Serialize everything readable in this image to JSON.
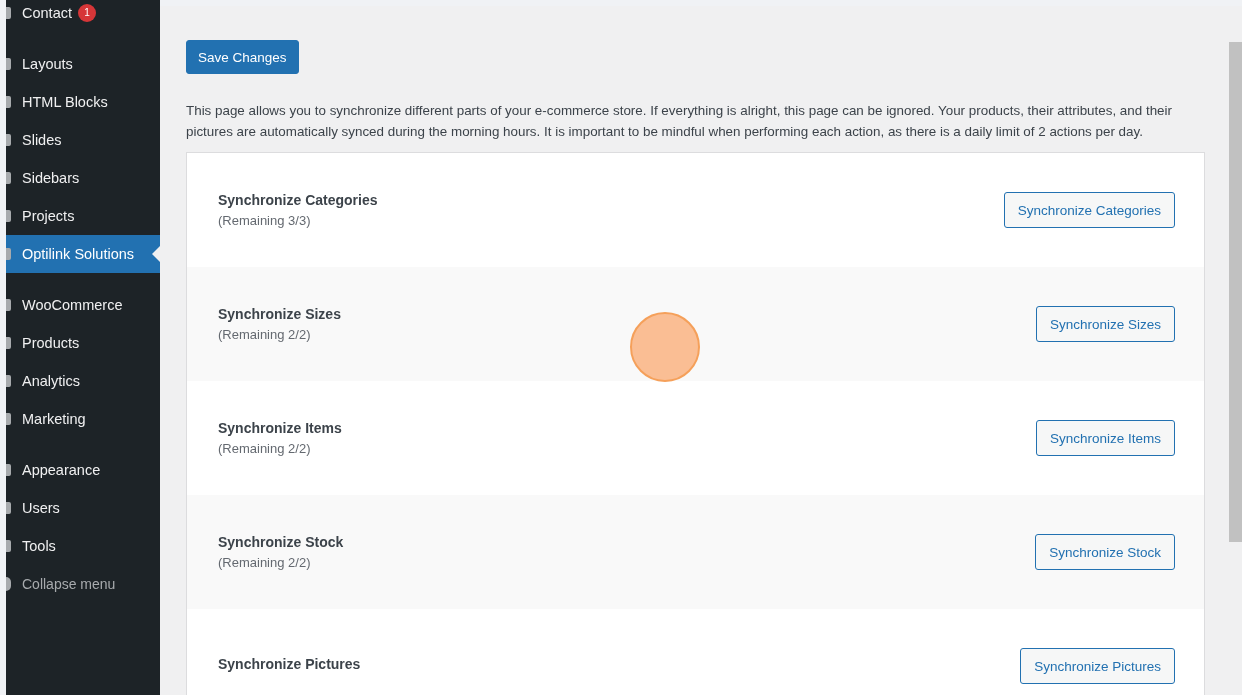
{
  "sidebar": {
    "items": [
      {
        "kind": "item",
        "label": "Contact",
        "badge": "1",
        "selected": false
      },
      {
        "kind": "separator"
      },
      {
        "kind": "item",
        "label": "Layouts",
        "selected": false
      },
      {
        "kind": "item",
        "label": "HTML Blocks",
        "selected": false
      },
      {
        "kind": "item",
        "label": "Slides",
        "selected": false
      },
      {
        "kind": "item",
        "label": "Sidebars",
        "selected": false
      },
      {
        "kind": "item",
        "label": "Projects",
        "selected": false
      },
      {
        "kind": "item",
        "label": "Optilink Solutions",
        "selected": true
      },
      {
        "kind": "separator"
      },
      {
        "kind": "item",
        "label": "WooCommerce",
        "selected": false
      },
      {
        "kind": "item",
        "label": "Products",
        "selected": false
      },
      {
        "kind": "item",
        "label": "Analytics",
        "selected": false
      },
      {
        "kind": "item",
        "label": "Marketing",
        "selected": false
      },
      {
        "kind": "separator"
      },
      {
        "kind": "item",
        "label": "Appearance",
        "selected": false
      },
      {
        "kind": "item",
        "label": "Users",
        "selected": false
      },
      {
        "kind": "item",
        "label": "Tools",
        "selected": false
      },
      {
        "kind": "collapse",
        "label": "Collapse menu",
        "selected": false
      }
    ]
  },
  "save_button": "Save Changes",
  "description": "This page allows you to synchronize different parts of your e-commerce store. If everything is alright, this page can be ignored. Your products, their attributes, and their pictures are automatically synced during the morning hours. It is important to be mindful when performing each action, as there is a daily limit of 2 actions per day.",
  "sync_rows": [
    {
      "title": "Synchronize Categories",
      "remaining": "(Remaining 3/3)",
      "button": "Synchronize Categories"
    },
    {
      "title": "Synchronize Sizes",
      "remaining": "(Remaining 2/2)",
      "button": "Synchronize Sizes"
    },
    {
      "title": "Synchronize Items",
      "remaining": "(Remaining 2/2)",
      "button": "Synchronize Items"
    },
    {
      "title": "Synchronize Stock",
      "remaining": "(Remaining 2/2)",
      "button": "Synchronize Stock"
    },
    {
      "title": "Synchronize Pictures",
      "button": "Synchronize Pictures"
    }
  ]
}
